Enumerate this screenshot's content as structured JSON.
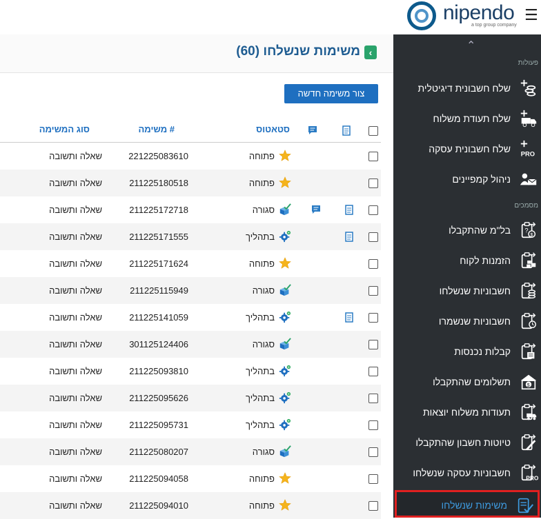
{
  "brand": {
    "name": "nipendo",
    "tagline": "a top group company"
  },
  "main": {
    "title": "משימות שנשלחו (60)",
    "new_task_button": "צור משימה חדשה",
    "columns": {
      "status": "סטאטוס",
      "task_no": "# משימה",
      "task_type": "סוג המשימה"
    },
    "rows": [
      {
        "status": "פתוחה",
        "status_icon": "star-icon",
        "task_no": "221225083610",
        "task_type": "שאלה ותשובה",
        "doc": false,
        "chat": false
      },
      {
        "status": "פתוחה",
        "status_icon": "star-icon",
        "task_no": "211225180518",
        "task_type": "שאלה ותשובה",
        "doc": false,
        "chat": false
      },
      {
        "status": "סגורה",
        "status_icon": "box-check-icon",
        "task_no": "211225172718",
        "task_type": "שאלה ותשובה",
        "doc": true,
        "chat": true
      },
      {
        "status": "בתהליך",
        "status_icon": "gear-icon",
        "task_no": "211225171555",
        "task_type": "שאלה ותשובה",
        "doc": true,
        "chat": false
      },
      {
        "status": "פתוחה",
        "status_icon": "star-icon",
        "task_no": "211225171624",
        "task_type": "שאלה ותשובה",
        "doc": false,
        "chat": false
      },
      {
        "status": "סגורה",
        "status_icon": "box-check-icon",
        "task_no": "211225115949",
        "task_type": "שאלה ותשובה",
        "doc": false,
        "chat": false
      },
      {
        "status": "בתהליך",
        "status_icon": "gear-icon",
        "task_no": "211225141059",
        "task_type": "שאלה ותשובה",
        "doc": true,
        "chat": false
      },
      {
        "status": "סגורה",
        "status_icon": "box-check-icon",
        "task_no": "301125124406",
        "task_type": "שאלה ותשובה",
        "doc": false,
        "chat": false
      },
      {
        "status": "בתהליך",
        "status_icon": "gear-icon",
        "task_no": "211225093810",
        "task_type": "שאלה ותשובה",
        "doc": false,
        "chat": false
      },
      {
        "status": "בתהליך",
        "status_icon": "gear-icon",
        "task_no": "211225095626",
        "task_type": "שאלה ותשובה",
        "doc": false,
        "chat": false
      },
      {
        "status": "בתהליך",
        "status_icon": "gear-icon",
        "task_no": "211225095731",
        "task_type": "שאלה ותשובה",
        "doc": false,
        "chat": false
      },
      {
        "status": "סגורה",
        "status_icon": "box-check-icon",
        "task_no": "211225080207",
        "task_type": "שאלה ותשובה",
        "doc": false,
        "chat": false
      },
      {
        "status": "פתוחה",
        "status_icon": "star-icon",
        "task_no": "211225094058",
        "task_type": "שאלה ותשובה",
        "doc": false,
        "chat": false
      },
      {
        "status": "פתוחה",
        "status_icon": "star-icon",
        "task_no": "211225094010",
        "task_type": "שאלה ותשובה",
        "doc": false,
        "chat": false
      }
    ]
  },
  "sidebar": {
    "section_actions": "פעולות",
    "section_docs": "מסמכים",
    "actions": [
      {
        "label": "שלח חשבונית דיגיטלית",
        "icon": "coins-plus-icon"
      },
      {
        "label": "שלח תעודת משלוח",
        "icon": "truck-plus-icon"
      },
      {
        "label": "שלח חשבונית עסקה",
        "icon": "pro-plus-icon"
      },
      {
        "label": "ניהול קמפיינים",
        "icon": "user-mail-icon"
      }
    ],
    "docs": [
      {
        "label": "בל\"מ שהתקבלו",
        "icon": "clipboard-dollar-icon"
      },
      {
        "label": "הזמנות לקוח",
        "icon": "clipboard-boxes-icon"
      },
      {
        "label": "חשבוניות שנשלחו",
        "icon": "clipboard-coins-icon"
      },
      {
        "label": "חשבוניות שנשמרו",
        "icon": "clipboard-clock-icon"
      },
      {
        "label": "קבלות נכנסות",
        "icon": "clipboard-receipt-icon"
      },
      {
        "label": "תשלומים שהתקבלו",
        "icon": "house-dollar-icon"
      },
      {
        "label": "תעודות משלוח יוצאות",
        "icon": "clipboard-truck-icon"
      },
      {
        "label": "טיוטות חשבון שהתקבלו",
        "icon": "clipboard-pencil-icon"
      },
      {
        "label": "חשבוניות עסקה שנשלחו",
        "icon": "clipboard-pro-icon"
      },
      {
        "label": "משימות שנשלחו",
        "icon": "task-check-icon",
        "active": true
      }
    ]
  },
  "colors": {
    "sidebar_bg": "#2b2f33",
    "accent": "#1e6fc0",
    "active_label": "#3e9be0",
    "highlight_border": "#e02020",
    "title": "#1e5c91"
  }
}
